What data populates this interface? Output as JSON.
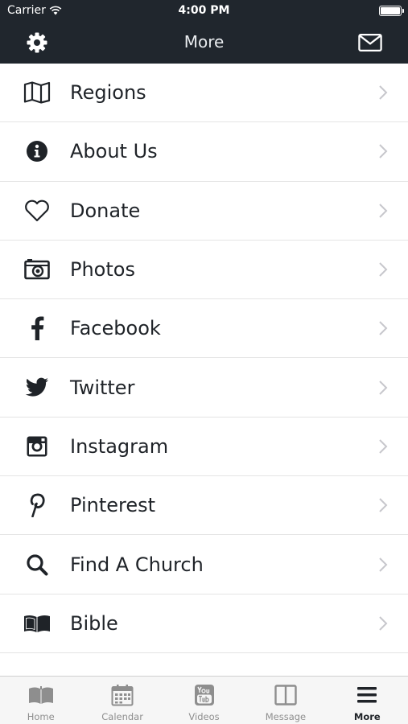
{
  "status_bar": {
    "carrier": "Carrier",
    "time": "4:00 PM",
    "battery_level": 1.0
  },
  "nav_bar": {
    "title": "More",
    "left_icon": "gear-icon",
    "right_icon": "envelope-icon",
    "background": "#20262d"
  },
  "menu": {
    "items": [
      {
        "label": "Regions",
        "icon": "map-icon"
      },
      {
        "label": "About Us",
        "icon": "info-circle-icon"
      },
      {
        "label": "Donate",
        "icon": "heart-icon"
      },
      {
        "label": "Photos",
        "icon": "camera-icon"
      },
      {
        "label": "Facebook",
        "icon": "facebook-icon"
      },
      {
        "label": "Twitter",
        "icon": "twitter-icon"
      },
      {
        "label": "Instagram",
        "icon": "instagram-icon"
      },
      {
        "label": "Pinterest",
        "icon": "pinterest-icon"
      },
      {
        "label": "Find A Church",
        "icon": "search-icon"
      },
      {
        "label": "Bible",
        "icon": "open-book-icon"
      }
    ]
  },
  "tab_bar": {
    "active": "More",
    "tabs": [
      {
        "label": "Home",
        "icon": "book-icon"
      },
      {
        "label": "Calendar",
        "icon": "calendar-icon"
      },
      {
        "label": "Videos",
        "icon": "youtube-icon"
      },
      {
        "label": "Message",
        "icon": "columns-icon"
      },
      {
        "label": "More",
        "icon": "hamburger-icon"
      }
    ]
  }
}
